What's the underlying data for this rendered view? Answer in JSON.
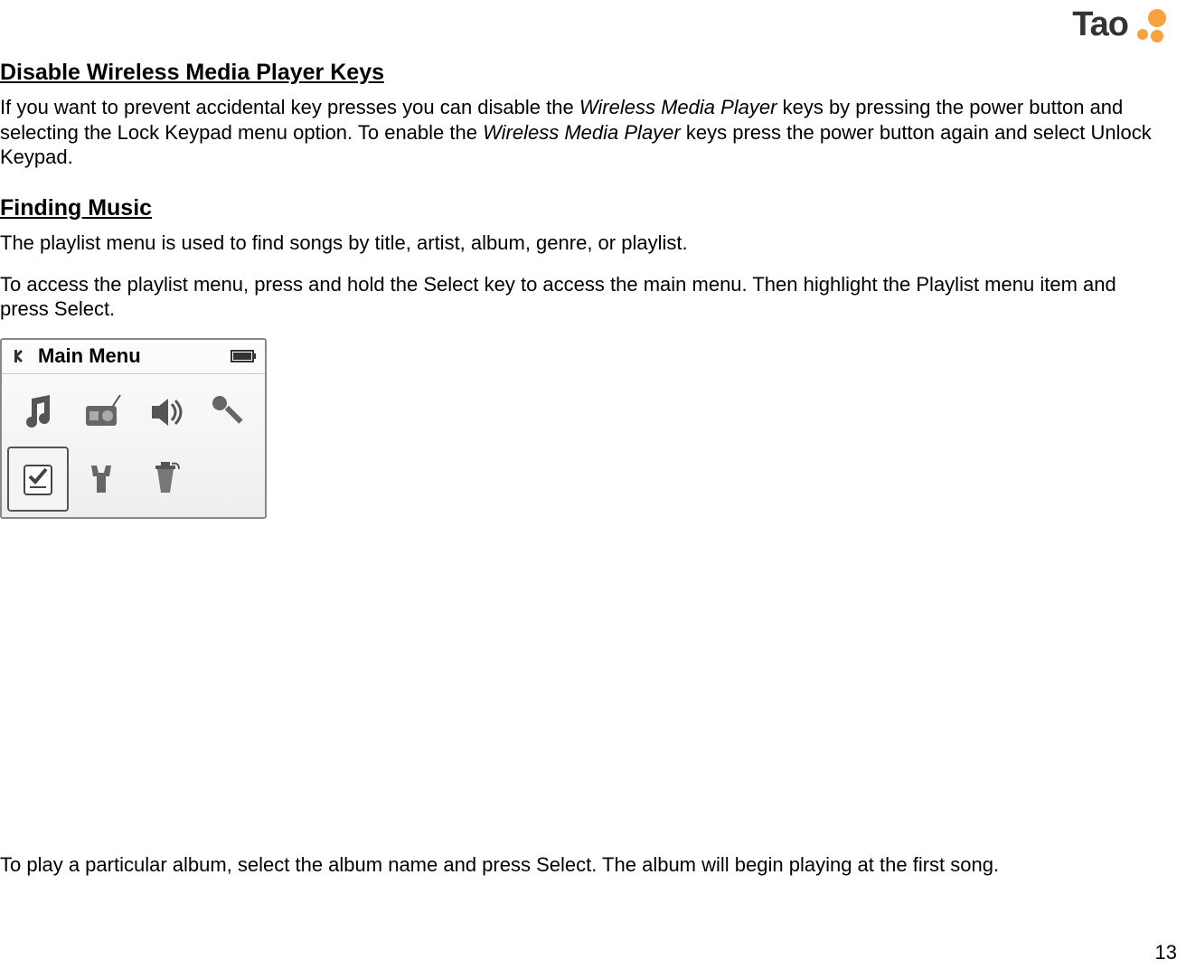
{
  "logo": {
    "text": "Tao"
  },
  "section1": {
    "heading": "Disable Wireless Media Player Keys",
    "para_part1": "If you want to prevent accidental key presses you can disable the ",
    "para_em1": "Wireless Media Player",
    "para_part2": " keys by pressing the power button and selecting the Lock Keypad menu option.  To enable the ",
    "para_em2": "Wireless Media Player",
    "para_part3": " keys press the power button again and select Unlock Keypad."
  },
  "section2": {
    "heading": "Finding Music",
    "para1": "The playlist menu is used to find songs by title, artist, album, genre, or playlist.",
    "para2": "To access the playlist menu, press and hold the Select key to access the main menu.  Then highlight the Playlist menu item and press Select."
  },
  "menu": {
    "title": "Main Menu",
    "icons": [
      "music",
      "radio",
      "speaker",
      "settings",
      "playlist",
      "tools",
      "delete",
      ""
    ]
  },
  "bottom": {
    "para": "To play a particular album, select the album name and press Select.  The album will begin playing at the first song."
  },
  "page_number": "13"
}
